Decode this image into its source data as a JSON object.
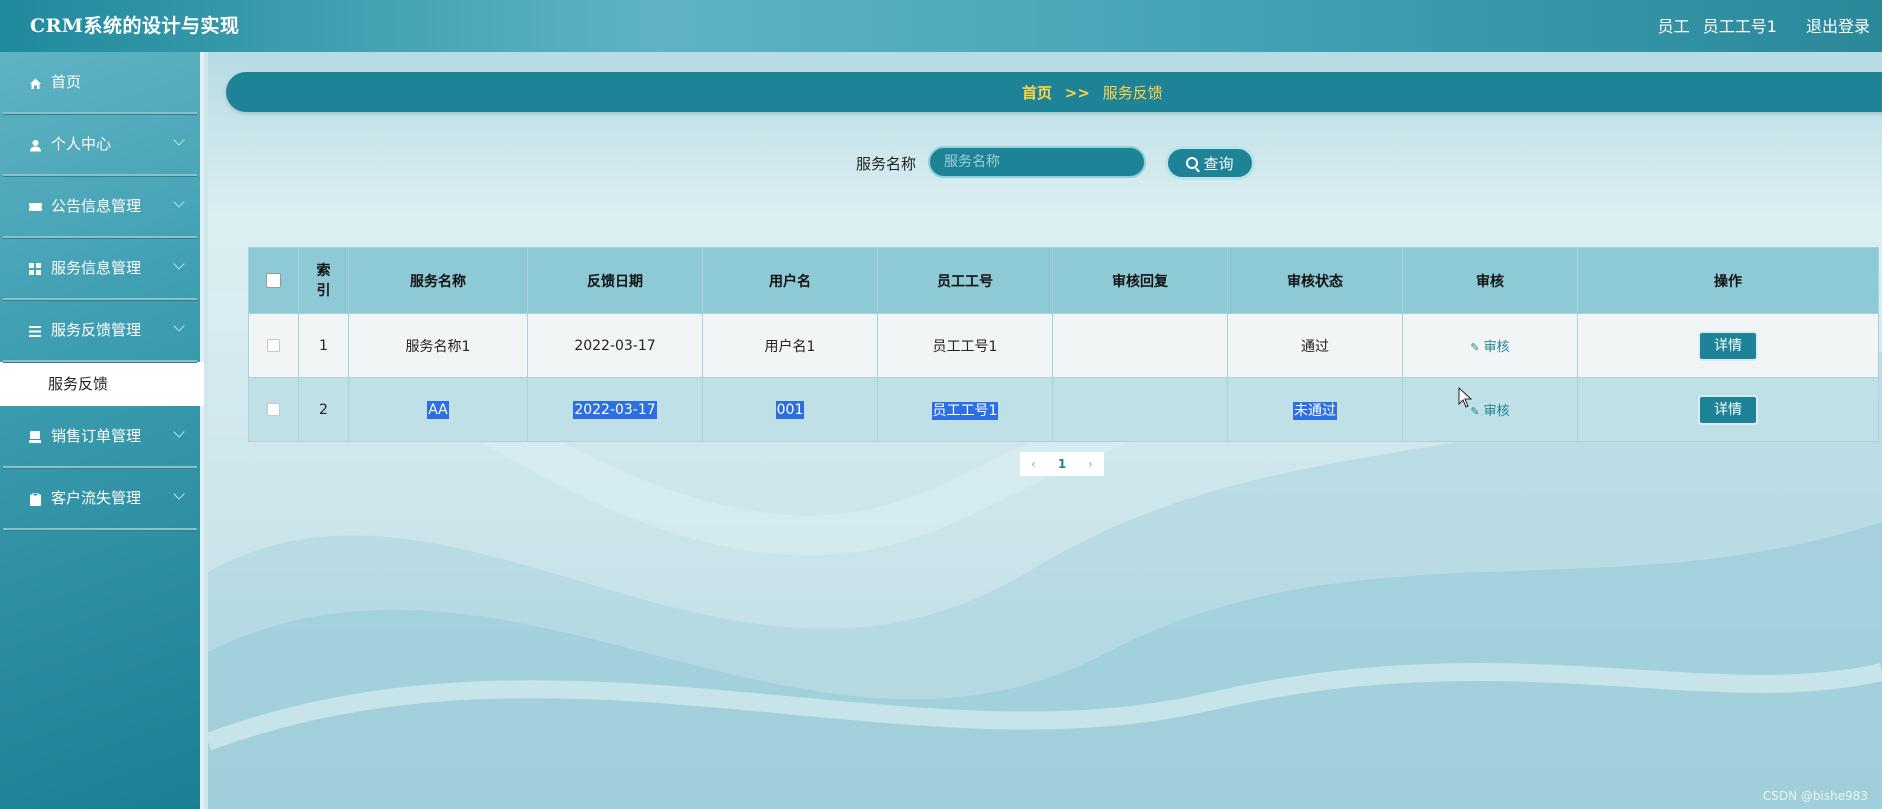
{
  "header": {
    "app_title": "CRM系统的设计与实现",
    "role": "员工",
    "username": "员工工号1",
    "logout": "退出登录"
  },
  "sidebar": {
    "items": [
      {
        "label": "首页",
        "icon": "home-icon"
      },
      {
        "label": "个人中心",
        "icon": "user-icon"
      },
      {
        "label": "公告信息管理",
        "icon": "ticket-icon"
      },
      {
        "label": "服务信息管理",
        "icon": "grid-icon"
      },
      {
        "label": "服务反馈管理",
        "icon": "list-icon"
      },
      {
        "label": "销售订单管理",
        "icon": "printer-icon"
      },
      {
        "label": "客户流失管理",
        "icon": "clipboard-icon"
      }
    ],
    "active_sub": "服务反馈"
  },
  "breadcrumb": {
    "home": "首页",
    "separator": ">>",
    "current": "服务反馈"
  },
  "search": {
    "label": "服务名称",
    "placeholder": "服务名称",
    "button": "查询"
  },
  "table": {
    "headers": [
      "索引",
      "服务名称",
      "反馈日期",
      "用户名",
      "员工工号",
      "审核回复",
      "审核状态",
      "审核",
      "操作"
    ],
    "rows": [
      {
        "index": "1",
        "service_name": "服务名称1",
        "date": "2022-03-17",
        "user": "用户名1",
        "emp_no": "员工工号1",
        "reply": "",
        "status": "通过",
        "audit": "审核",
        "action": "详情"
      },
      {
        "index": "2",
        "service_name": "AA",
        "date": "2022-03-17",
        "user": "001",
        "emp_no": "员工工号1",
        "reply": "",
        "status": "未通过",
        "audit": "审核",
        "action": "详情"
      }
    ]
  },
  "pagination": {
    "current_page": "1"
  },
  "watermark": "CSDN @bishe983",
  "colors": {
    "primary": "#1e8396",
    "accent_yellow": "#ffd24a",
    "selection": "#2d6fe0"
  }
}
